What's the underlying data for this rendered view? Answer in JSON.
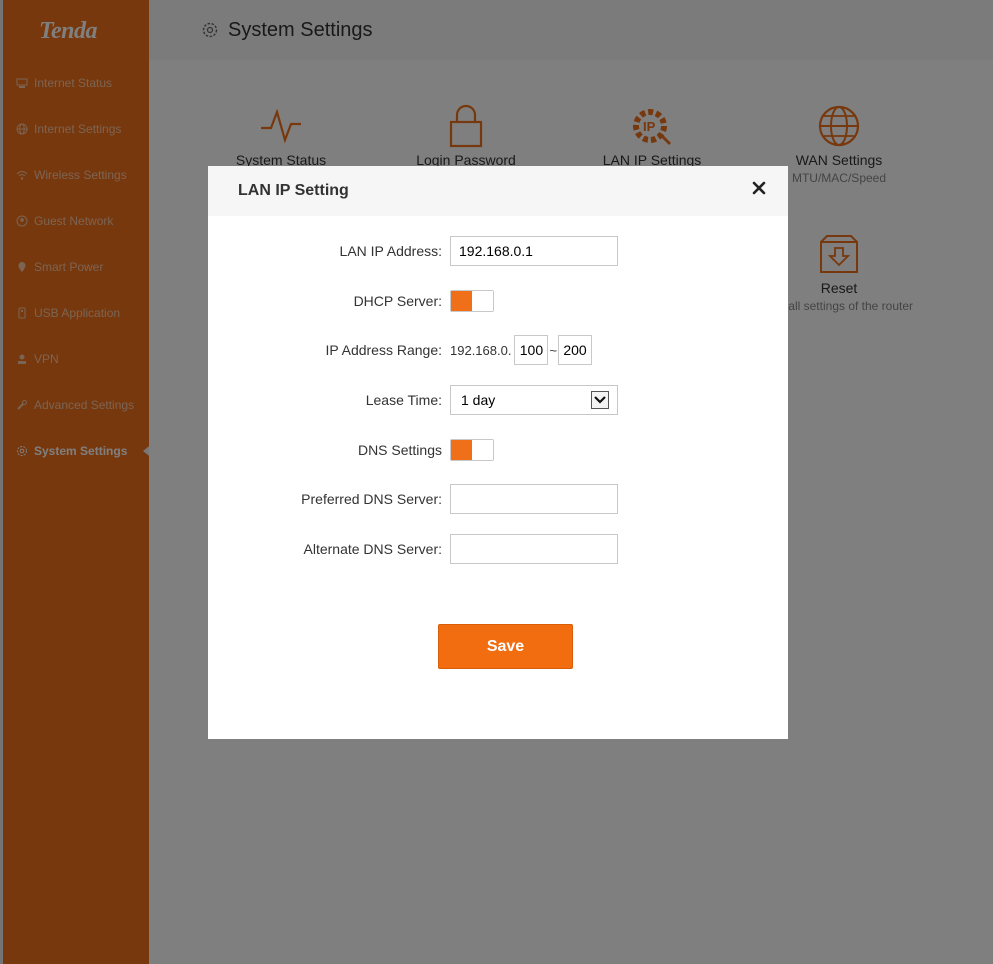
{
  "sidebar": {
    "logo": "Tenda",
    "items": [
      {
        "label": "Internet Status",
        "icon": "globe-status-icon"
      },
      {
        "label": "Internet Settings",
        "icon": "globe-icon"
      },
      {
        "label": "Wireless Settings",
        "icon": "wifi-icon"
      },
      {
        "label": "Guest Network",
        "icon": "guest-icon"
      },
      {
        "label": "Smart Power",
        "icon": "power-pin-icon"
      },
      {
        "label": "USB Application",
        "icon": "usb-icon"
      },
      {
        "label": "VPN",
        "icon": "vpn-icon"
      },
      {
        "label": "Advanced Settings",
        "icon": "wrench-icon"
      },
      {
        "label": "System Settings",
        "icon": "gear-icon",
        "active": true
      }
    ]
  },
  "header": {
    "title": "System Settings"
  },
  "tiles": [
    {
      "label": "System Status",
      "sub": ""
    },
    {
      "label": "Login Password",
      "sub": ""
    },
    {
      "label": "LAN IP Settings",
      "sub": ""
    },
    {
      "label": "WAN Settings",
      "sub": "MTU/MAC/Speed"
    },
    {
      "label": "Reset",
      "sub": "lear all settings of the router"
    }
  ],
  "modal": {
    "title": "LAN IP Setting",
    "fields": {
      "lan_ip_label": "LAN IP Address:",
      "lan_ip_value": "192.168.0.1",
      "dhcp_label": "DHCP Server:",
      "dhcp_on": true,
      "range_label": "IP Address Range:",
      "range_prefix": "192.168.0.",
      "range_start": "100",
      "range_sep": "~",
      "range_end": "200",
      "lease_label": "Lease Time:",
      "lease_value": "1 day",
      "dns_label": "DNS Settings",
      "dns_on": true,
      "pref_dns_label": "Preferred DNS Server:",
      "pref_dns_value": "",
      "alt_dns_label": "Alternate DNS Server:",
      "alt_dns_value": ""
    },
    "save_label": "Save"
  },
  "colors": {
    "accent": "#f0701a",
    "button": "#f26c10",
    "overlay": "rgba(0,0,0,0.5)"
  }
}
